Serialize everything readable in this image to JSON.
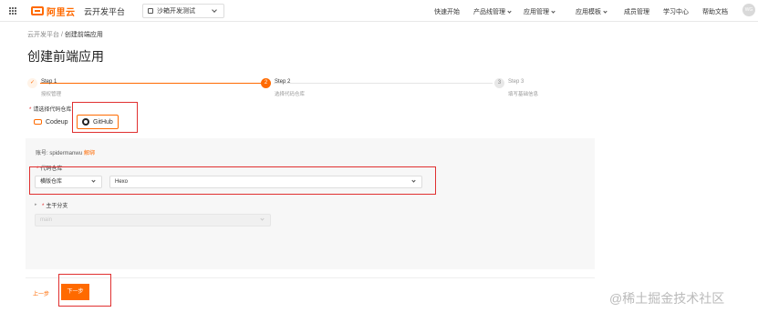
{
  "topbar": {
    "brand": "阿里云",
    "product": "云开发平台",
    "space": "沙箱开发测试",
    "nav": [
      {
        "label": "快速开始",
        "has_menu": false
      },
      {
        "label": "产品线管理",
        "has_menu": true
      },
      {
        "label": "应用管理",
        "has_menu": true
      },
      {
        "label": "应用模板",
        "has_menu": true
      },
      {
        "label": "成员管理",
        "has_menu": false
      },
      {
        "label": "学习中心",
        "has_menu": false
      },
      {
        "label": "帮助文档",
        "has_menu": false
      }
    ],
    "avatar": "WG"
  },
  "breadcrumb": {
    "root": "云开发平台",
    "sep": " / ",
    "current": "创建前端应用"
  },
  "page_title": "创建前端应用",
  "steps": [
    {
      "title": "Step 1",
      "desc": "授权管理",
      "status": "done",
      "number": "✓"
    },
    {
      "title": "Step 2",
      "desc": "选择代码仓库",
      "status": "current",
      "number": "2"
    },
    {
      "title": "Step 3",
      "desc": "填写基础信息",
      "status": "wait",
      "number": "3"
    }
  ],
  "repo_label": "请选择代码仓库",
  "repos": [
    {
      "label": "Codeup",
      "icon": "codeup-icon",
      "selected": false
    },
    {
      "label": "GitHub",
      "icon": "github-icon",
      "selected": true
    }
  ],
  "form": {
    "account_label": "账号:",
    "account_value": "spidermanwu",
    "authorize_link": "解绑",
    "repo_field_label": "代码仓库",
    "repo_type": "横版仓库",
    "repo_name": "Hexo",
    "branch_label": "主干分支",
    "branch_value": "main"
  },
  "buttons": {
    "prev": "上一步",
    "next": "下一步"
  },
  "watermark": "@稀土掘金技术社区",
  "colors": {
    "accent": "#ff6a00",
    "highlight": "#e03030"
  }
}
